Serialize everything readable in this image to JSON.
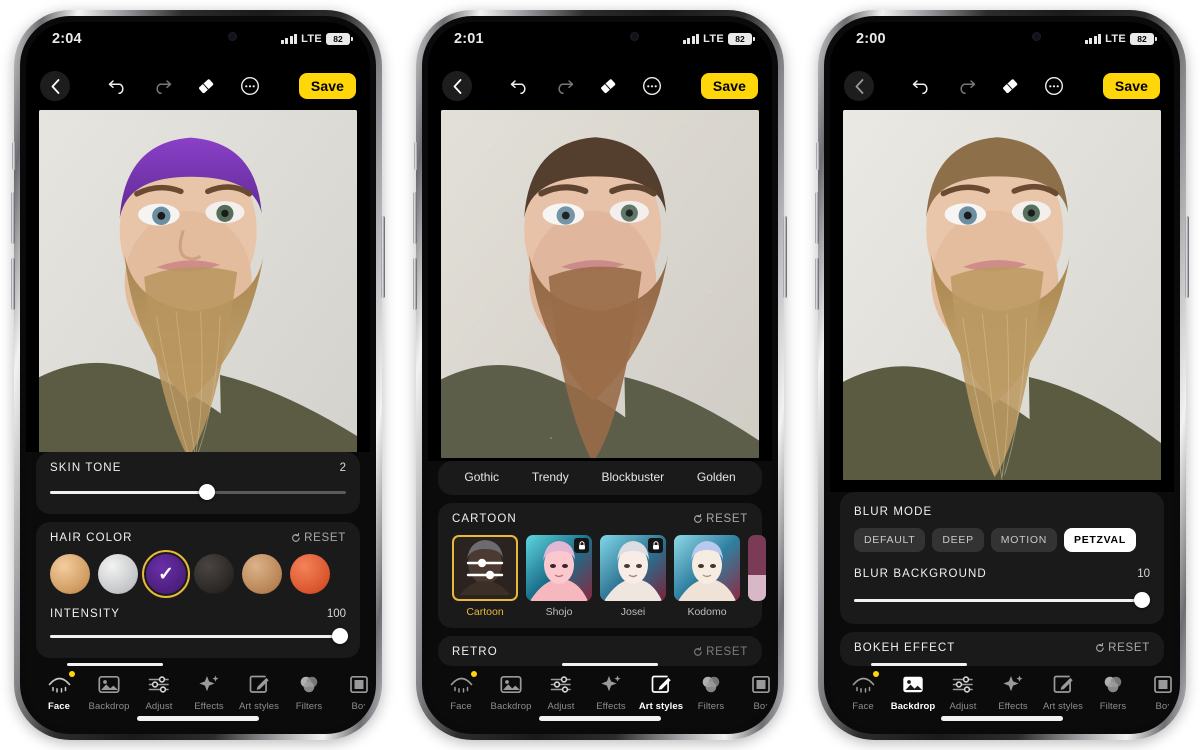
{
  "phones": [
    {
      "id": "phone-face",
      "status": {
        "time": "2:04",
        "network": "LTE",
        "battery": "82"
      },
      "toolbar": {
        "back": "‹",
        "undo": "undo-icon",
        "redo": "redo-icon",
        "eraser": "eraser-icon",
        "more": "more-icon",
        "save_label": "Save"
      },
      "panels": {
        "skin_tone": {
          "title": "SKIN TONE",
          "value": "2",
          "percent": 53
        },
        "hair_color": {
          "title": "HAIR COLOR",
          "reset": "RESET",
          "swatches": [
            "blonde",
            "silver",
            "purple",
            "black",
            "light-brown",
            "copper-red"
          ],
          "selected_index": 2,
          "intensity_label": "INTENSITY",
          "intensity_value": "100",
          "intensity_percent": 100
        }
      },
      "tabs": [
        {
          "label": "Face",
          "icon": "face-icon",
          "active": true,
          "badge": true
        },
        {
          "label": "Backdrop",
          "icon": "backdrop-icon",
          "active": false,
          "badge": false
        },
        {
          "label": "Adjust",
          "icon": "adjust-icon",
          "active": false,
          "badge": false
        },
        {
          "label": "Effects",
          "icon": "effects-icon",
          "active": false,
          "badge": false
        },
        {
          "label": "Art styles",
          "icon": "art-styles-icon",
          "active": false,
          "badge": false
        },
        {
          "label": "Filters",
          "icon": "filters-icon",
          "active": false,
          "badge": false
        },
        {
          "label": "Bor",
          "icon": "borders-icon",
          "active": false,
          "badge": false
        }
      ]
    },
    {
      "id": "phone-art-styles",
      "status": {
        "time": "2:01",
        "network": "LTE",
        "battery": "82"
      },
      "toolbar": {
        "back": "‹",
        "undo": "undo-icon",
        "redo": "redo-icon",
        "eraser": "eraser-icon",
        "more": "more-icon",
        "save_label": "Save"
      },
      "panels": {
        "chips": [
          "Gothic",
          "Trendy",
          "Blockbuster",
          "Golden"
        ],
        "cartoon": {
          "title": "CARTOON",
          "reset": "RESET",
          "items": [
            {
              "label": "Cartoon",
              "selected": true,
              "locked": false
            },
            {
              "label": "Shojo",
              "selected": false,
              "locked": true
            },
            {
              "label": "Josei",
              "selected": false,
              "locked": true
            },
            {
              "label": "Kodomo",
              "selected": false,
              "locked": false
            }
          ]
        },
        "retro": {
          "title": "RETRO",
          "reset": "RESET"
        }
      },
      "tabs": [
        {
          "label": "Face",
          "icon": "face-icon",
          "active": false,
          "badge": true
        },
        {
          "label": "Backdrop",
          "icon": "backdrop-icon",
          "active": false,
          "badge": false
        },
        {
          "label": "Adjust",
          "icon": "adjust-icon",
          "active": false,
          "badge": false
        },
        {
          "label": "Effects",
          "icon": "effects-icon",
          "active": false,
          "badge": false
        },
        {
          "label": "Art styles",
          "icon": "art-styles-icon",
          "active": true,
          "badge": false
        },
        {
          "label": "Filters",
          "icon": "filters-icon",
          "active": false,
          "badge": false
        },
        {
          "label": "Bor",
          "icon": "borders-icon",
          "active": false,
          "badge": false
        }
      ]
    },
    {
      "id": "phone-backdrop",
      "status": {
        "time": "2:00",
        "network": "LTE",
        "battery": "82"
      },
      "toolbar": {
        "back": "‹",
        "undo": "undo-icon",
        "redo": "redo-icon",
        "eraser": "eraser-icon",
        "more": "more-icon",
        "save_label": "Save"
      },
      "panels": {
        "blur_mode": {
          "title": "BLUR MODE",
          "options": [
            "DEFAULT",
            "DEEP",
            "MOTION",
            "PETZVAL"
          ],
          "selected": "PETZVAL"
        },
        "blur_background": {
          "title": "BLUR BACKGROUND",
          "value": "10",
          "percent": 98
        },
        "bokeh_effect": {
          "title": "BOKEH EFFECT",
          "reset": "RESET"
        }
      },
      "tabs": [
        {
          "label": "Face",
          "icon": "face-icon",
          "active": false,
          "badge": true
        },
        {
          "label": "Backdrop",
          "icon": "backdrop-icon",
          "active": true,
          "badge": false
        },
        {
          "label": "Adjust",
          "icon": "adjust-icon",
          "active": false,
          "badge": false
        },
        {
          "label": "Effects",
          "icon": "effects-icon",
          "active": false,
          "badge": false
        },
        {
          "label": "Art styles",
          "icon": "art-styles-icon",
          "active": false,
          "badge": false
        },
        {
          "label": "Filters",
          "icon": "filters-icon",
          "active": false,
          "badge": false
        },
        {
          "label": "Bor",
          "icon": "borders-icon",
          "active": false,
          "badge": false
        }
      ]
    }
  ],
  "colors": {
    "accent_yellow": "#ffd60a",
    "gold_outline": "#e8b93a",
    "panel_bg": "#1a1a1a",
    "screen_bg": "#0b0b0b"
  }
}
